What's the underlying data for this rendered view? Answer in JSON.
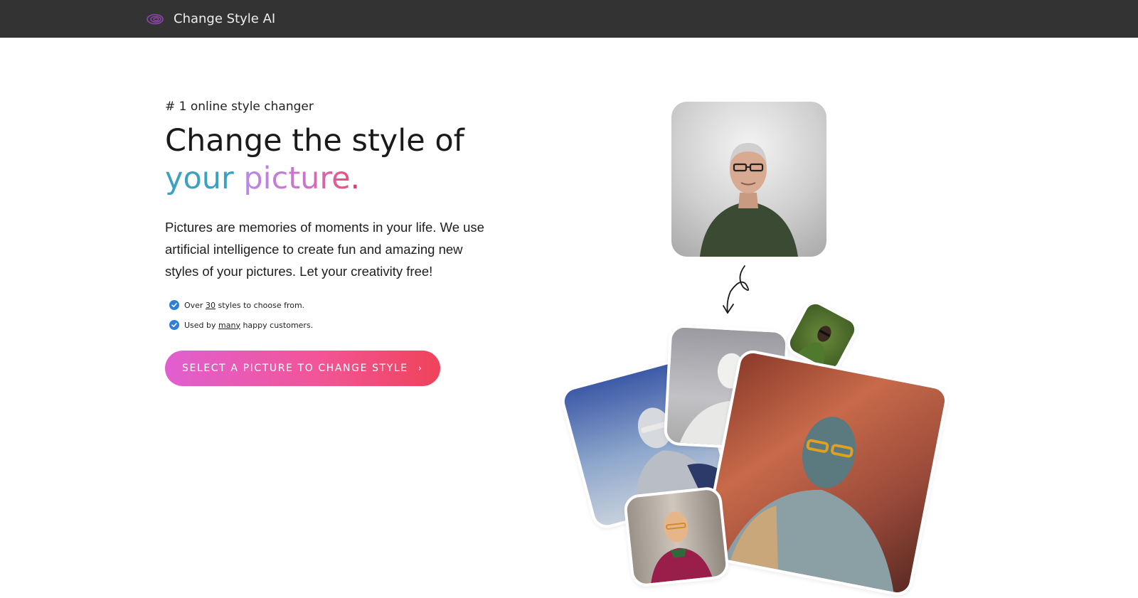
{
  "brand": {
    "name": "Change Style AI",
    "logo_icon": "swirl-logo-icon",
    "logo_color": "#8e44ad"
  },
  "hero": {
    "eyebrow": "# 1 online style changer",
    "headline_line1": "Change the style of",
    "headline_your": "your",
    "headline_picture": "picture",
    "headline_dot": ".",
    "description": "Pictures are memories of moments in your life. We use artificial intelligence to create fun and amazing new styles of your pictures. Let your creativity free!",
    "features": [
      {
        "before": "Over ",
        "emphasis": "30",
        "after": " styles to choose from."
      },
      {
        "before": "Used by ",
        "emphasis": "many",
        "after": " happy customers."
      }
    ],
    "cta_label": "SELECT A PICTURE TO CHANGE STYLE",
    "cta_icon": "chevron-right-icon"
  },
  "colors": {
    "topbar": "#333333",
    "accent_blue": "#3aa2c0",
    "accent_pink": "#e33c6c",
    "check_blue": "#2f7fd6",
    "cta_gradient_start": "#e05fd0",
    "cta_gradient_end": "#f0435a"
  },
  "gallery": {
    "original": "man-portrait-photo",
    "arrow_icon": "curly-arrow-down-icon",
    "styled": [
      "silver-statue-photo",
      "gray-plaster-photo",
      "green-grass-photo",
      "bronze-statue-photo",
      "wood-carving-photo"
    ]
  }
}
